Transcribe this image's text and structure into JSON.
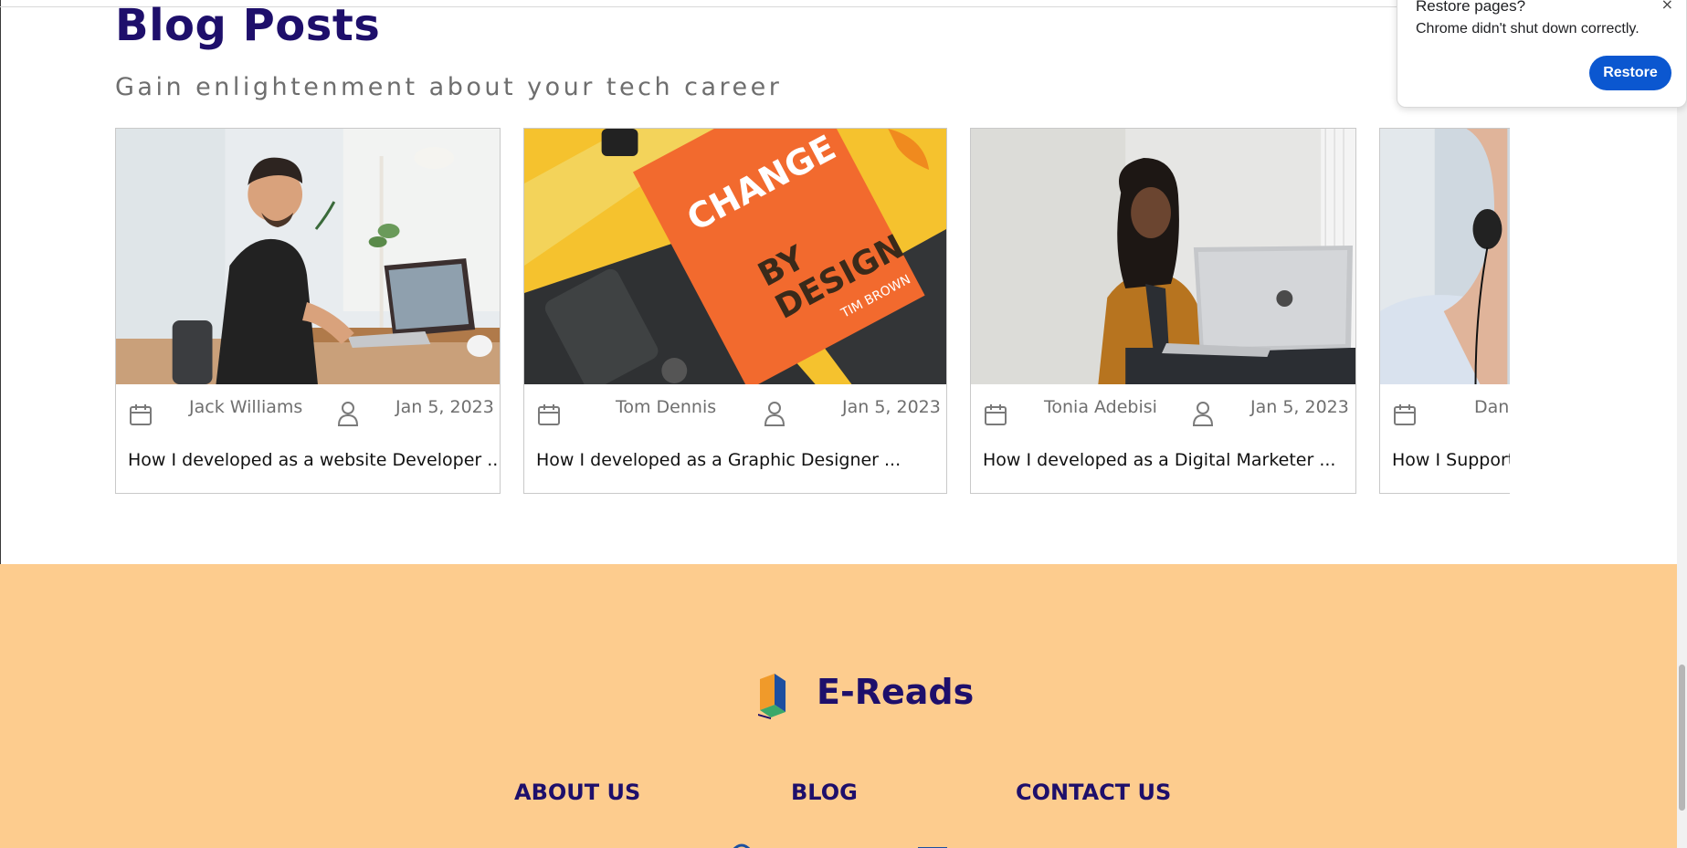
{
  "blog": {
    "title": "Blog Posts",
    "subtitle": "Gain enlightenment about your tech career",
    "posts": [
      {
        "author": "Jack Williams",
        "date": "Jan 5, 2023",
        "title": "How I developed as a website Developer ..."
      },
      {
        "author": "Tom Dennis",
        "date": "Jan 5, 2023",
        "title": "How I developed as a Graphic Designer ..."
      },
      {
        "author": "Tonia Adebisi",
        "date": "Jan 5, 2023",
        "title": "How I developed as a Digital Marketer ..."
      },
      {
        "author": "Dani",
        "date": "",
        "title": "How I Support"
      }
    ],
    "book_cover": {
      "line1": "CHANGE",
      "line2": "BY",
      "line3": "DESIGN",
      "author": "TIM BROWN"
    }
  },
  "footer": {
    "brand": "E-Reads",
    "nav": [
      "ABOUT US",
      "BLOG",
      "CONTACT US"
    ],
    "background": "#fdcc8e"
  },
  "popup": {
    "title": "Restore pages?",
    "message": "Chrome didn't shut down correctly.",
    "button": "Restore",
    "close": "×"
  },
  "colors": {
    "brand_navy": "#1e0f6b",
    "button_blue": "#0b57d0"
  },
  "icons": [
    "calendar-icon",
    "person-icon",
    "close-icon",
    "ereads-logo-icon"
  ]
}
